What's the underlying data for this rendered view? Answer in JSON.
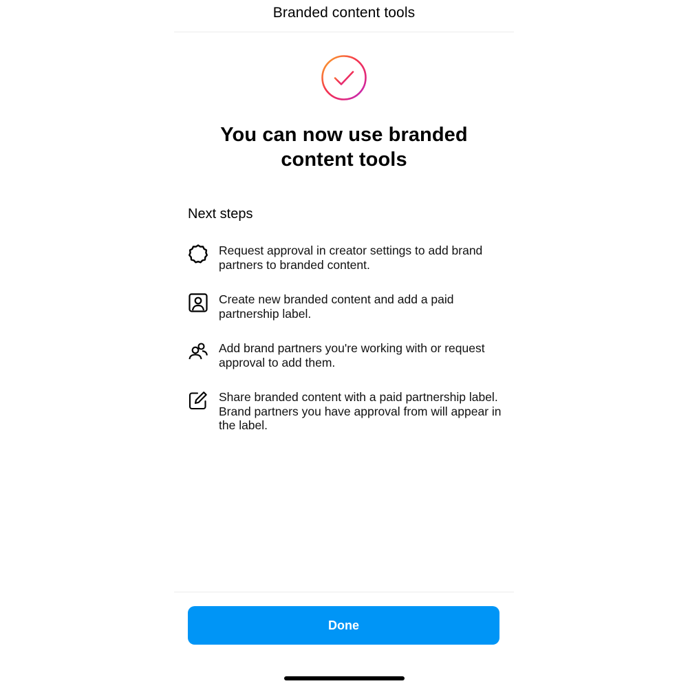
{
  "header": {
    "title": "Branded content tools"
  },
  "success": {
    "icon": "checkmark-circle-gradient-icon",
    "gradient_colors": [
      "#f9a825",
      "#ee2a7b",
      "#c13584",
      "#d300c5"
    ],
    "headline_line1": "You can now use branded",
    "headline_line2": "content tools"
  },
  "next_steps": {
    "title": "Next steps",
    "items": [
      {
        "icon": "badge-gear-icon",
        "text": "Request approval in creator settings to add brand partners to branded content."
      },
      {
        "icon": "person-frame-icon",
        "text": "Create new branded content and add a paid partnership label."
      },
      {
        "icon": "people-icon",
        "text": "Add brand partners you're working with or request approval to add them."
      },
      {
        "icon": "edit-pencil-icon",
        "text": "Share branded content with a paid partnership label. Brand partners you have approval from will appear in the label."
      }
    ]
  },
  "footer": {
    "done_label": "Done",
    "button_color": "#0095f6"
  }
}
